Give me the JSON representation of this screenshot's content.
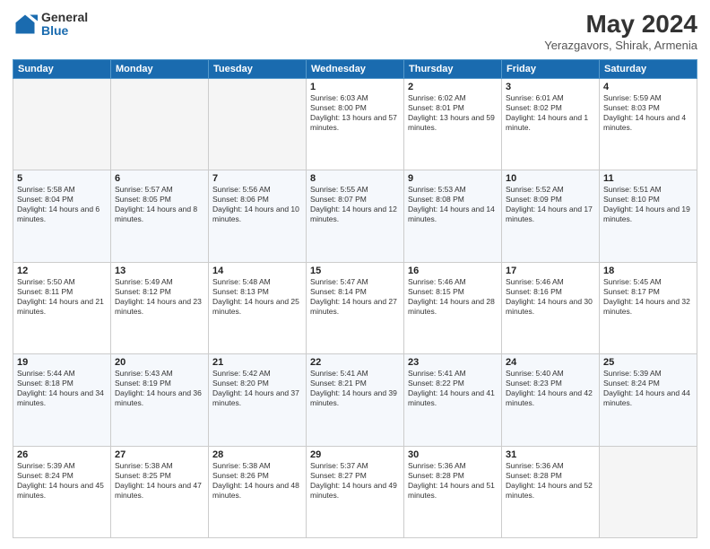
{
  "header": {
    "logo_general": "General",
    "logo_blue": "Blue",
    "title": "May 2024",
    "subtitle": "Yerazgavors, Shirak, Armenia"
  },
  "calendar": {
    "days_of_week": [
      "Sunday",
      "Monday",
      "Tuesday",
      "Wednesday",
      "Thursday",
      "Friday",
      "Saturday"
    ],
    "weeks": [
      {
        "days": [
          {
            "number": "",
            "sunrise": "",
            "sunset": "",
            "daylight": "",
            "empty": true
          },
          {
            "number": "",
            "sunrise": "",
            "sunset": "",
            "daylight": "",
            "empty": true
          },
          {
            "number": "",
            "sunrise": "",
            "sunset": "",
            "daylight": "",
            "empty": true
          },
          {
            "number": "1",
            "sunrise": "Sunrise: 6:03 AM",
            "sunset": "Sunset: 8:00 PM",
            "daylight": "Daylight: 13 hours and 57 minutes."
          },
          {
            "number": "2",
            "sunrise": "Sunrise: 6:02 AM",
            "sunset": "Sunset: 8:01 PM",
            "daylight": "Daylight: 13 hours and 59 minutes."
          },
          {
            "number": "3",
            "sunrise": "Sunrise: 6:01 AM",
            "sunset": "Sunset: 8:02 PM",
            "daylight": "Daylight: 14 hours and 1 minute."
          },
          {
            "number": "4",
            "sunrise": "Sunrise: 5:59 AM",
            "sunset": "Sunset: 8:03 PM",
            "daylight": "Daylight: 14 hours and 4 minutes."
          }
        ]
      },
      {
        "days": [
          {
            "number": "5",
            "sunrise": "Sunrise: 5:58 AM",
            "sunset": "Sunset: 8:04 PM",
            "daylight": "Daylight: 14 hours and 6 minutes."
          },
          {
            "number": "6",
            "sunrise": "Sunrise: 5:57 AM",
            "sunset": "Sunset: 8:05 PM",
            "daylight": "Daylight: 14 hours and 8 minutes."
          },
          {
            "number": "7",
            "sunrise": "Sunrise: 5:56 AM",
            "sunset": "Sunset: 8:06 PM",
            "daylight": "Daylight: 14 hours and 10 minutes."
          },
          {
            "number": "8",
            "sunrise": "Sunrise: 5:55 AM",
            "sunset": "Sunset: 8:07 PM",
            "daylight": "Daylight: 14 hours and 12 minutes."
          },
          {
            "number": "9",
            "sunrise": "Sunrise: 5:53 AM",
            "sunset": "Sunset: 8:08 PM",
            "daylight": "Daylight: 14 hours and 14 minutes."
          },
          {
            "number": "10",
            "sunrise": "Sunrise: 5:52 AM",
            "sunset": "Sunset: 8:09 PM",
            "daylight": "Daylight: 14 hours and 17 minutes."
          },
          {
            "number": "11",
            "sunrise": "Sunrise: 5:51 AM",
            "sunset": "Sunset: 8:10 PM",
            "daylight": "Daylight: 14 hours and 19 minutes."
          }
        ]
      },
      {
        "days": [
          {
            "number": "12",
            "sunrise": "Sunrise: 5:50 AM",
            "sunset": "Sunset: 8:11 PM",
            "daylight": "Daylight: 14 hours and 21 minutes."
          },
          {
            "number": "13",
            "sunrise": "Sunrise: 5:49 AM",
            "sunset": "Sunset: 8:12 PM",
            "daylight": "Daylight: 14 hours and 23 minutes."
          },
          {
            "number": "14",
            "sunrise": "Sunrise: 5:48 AM",
            "sunset": "Sunset: 8:13 PM",
            "daylight": "Daylight: 14 hours and 25 minutes."
          },
          {
            "number": "15",
            "sunrise": "Sunrise: 5:47 AM",
            "sunset": "Sunset: 8:14 PM",
            "daylight": "Daylight: 14 hours and 27 minutes."
          },
          {
            "number": "16",
            "sunrise": "Sunrise: 5:46 AM",
            "sunset": "Sunset: 8:15 PM",
            "daylight": "Daylight: 14 hours and 28 minutes."
          },
          {
            "number": "17",
            "sunrise": "Sunrise: 5:46 AM",
            "sunset": "Sunset: 8:16 PM",
            "daylight": "Daylight: 14 hours and 30 minutes."
          },
          {
            "number": "18",
            "sunrise": "Sunrise: 5:45 AM",
            "sunset": "Sunset: 8:17 PM",
            "daylight": "Daylight: 14 hours and 32 minutes."
          }
        ]
      },
      {
        "days": [
          {
            "number": "19",
            "sunrise": "Sunrise: 5:44 AM",
            "sunset": "Sunset: 8:18 PM",
            "daylight": "Daylight: 14 hours and 34 minutes."
          },
          {
            "number": "20",
            "sunrise": "Sunrise: 5:43 AM",
            "sunset": "Sunset: 8:19 PM",
            "daylight": "Daylight: 14 hours and 36 minutes."
          },
          {
            "number": "21",
            "sunrise": "Sunrise: 5:42 AM",
            "sunset": "Sunset: 8:20 PM",
            "daylight": "Daylight: 14 hours and 37 minutes."
          },
          {
            "number": "22",
            "sunrise": "Sunrise: 5:41 AM",
            "sunset": "Sunset: 8:21 PM",
            "daylight": "Daylight: 14 hours and 39 minutes."
          },
          {
            "number": "23",
            "sunrise": "Sunrise: 5:41 AM",
            "sunset": "Sunset: 8:22 PM",
            "daylight": "Daylight: 14 hours and 41 minutes."
          },
          {
            "number": "24",
            "sunrise": "Sunrise: 5:40 AM",
            "sunset": "Sunset: 8:23 PM",
            "daylight": "Daylight: 14 hours and 42 minutes."
          },
          {
            "number": "25",
            "sunrise": "Sunrise: 5:39 AM",
            "sunset": "Sunset: 8:24 PM",
            "daylight": "Daylight: 14 hours and 44 minutes."
          }
        ]
      },
      {
        "days": [
          {
            "number": "26",
            "sunrise": "Sunrise: 5:39 AM",
            "sunset": "Sunset: 8:24 PM",
            "daylight": "Daylight: 14 hours and 45 minutes."
          },
          {
            "number": "27",
            "sunrise": "Sunrise: 5:38 AM",
            "sunset": "Sunset: 8:25 PM",
            "daylight": "Daylight: 14 hours and 47 minutes."
          },
          {
            "number": "28",
            "sunrise": "Sunrise: 5:38 AM",
            "sunset": "Sunset: 8:26 PM",
            "daylight": "Daylight: 14 hours and 48 minutes."
          },
          {
            "number": "29",
            "sunrise": "Sunrise: 5:37 AM",
            "sunset": "Sunset: 8:27 PM",
            "daylight": "Daylight: 14 hours and 49 minutes."
          },
          {
            "number": "30",
            "sunrise": "Sunrise: 5:36 AM",
            "sunset": "Sunset: 8:28 PM",
            "daylight": "Daylight: 14 hours and 51 minutes."
          },
          {
            "number": "31",
            "sunrise": "Sunrise: 5:36 AM",
            "sunset": "Sunset: 8:28 PM",
            "daylight": "Daylight: 14 hours and 52 minutes."
          },
          {
            "number": "",
            "sunrise": "",
            "sunset": "",
            "daylight": "",
            "empty": true
          }
        ]
      }
    ]
  }
}
